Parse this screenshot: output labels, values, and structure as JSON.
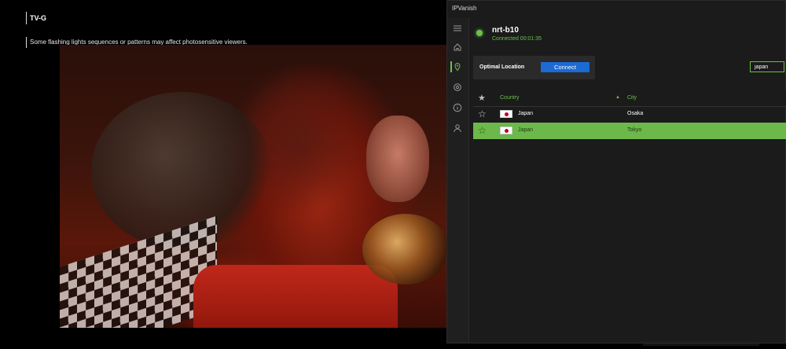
{
  "player": {
    "rating": "TV-G",
    "advisory": "Some flashing lights sequences or patterns may affect photosensitive viewers."
  },
  "vpn": {
    "app_title": "IPVanish",
    "server_name": "nrt-b10",
    "connection_status": "Connected 00:01:35",
    "optimal_label": "Optimal Location",
    "connect_label": "Connect",
    "search_value": "japan",
    "nav_icons": [
      "menu-icon",
      "home-icon",
      "location-pin-icon",
      "settings-icon",
      "info-icon",
      "account-icon"
    ],
    "table": {
      "columns": [
        "Country",
        "City"
      ],
      "sort_column": "Country",
      "rows": [
        {
          "country": "Japan",
          "city": "Osaka",
          "selected": false
        },
        {
          "country": "Japan",
          "city": "Tokyo",
          "selected": true
        }
      ]
    },
    "colors": {
      "accent": "#6cc04a",
      "button": "#1c6ad4",
      "selected_row": "#6cb84a",
      "background": "#1b1b1b"
    }
  }
}
